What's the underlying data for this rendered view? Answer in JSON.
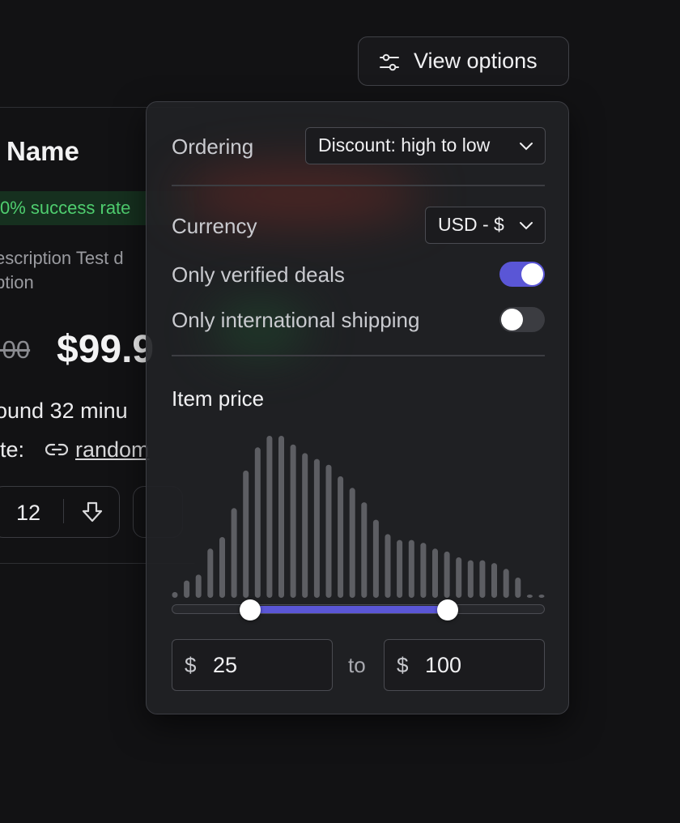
{
  "background_card": {
    "name": "Name",
    "success_rate": "0% success rate",
    "description_line1": "escription Test d",
    "description_line2": "ption",
    "old_price": ".00",
    "price": "$99.9",
    "found": "ound 32 minu",
    "site_label": "ite:",
    "site_link": "random",
    "vote_count": "12"
  },
  "view_options_button": {
    "label": "View options",
    "icon": "sliders-icon"
  },
  "panel": {
    "ordering": {
      "label": "Ordering",
      "selected": "Discount: high to low"
    },
    "currency": {
      "label": "Currency",
      "selected": "USD - $"
    },
    "only_verified_deals": {
      "label": "Only verified deals",
      "enabled": true
    },
    "only_international_shipping": {
      "label": "Only international shipping",
      "enabled": false
    },
    "item_price": {
      "title": "Item price",
      "histogram_counts": [
        2,
        6,
        8,
        17,
        21,
        31,
        44,
        52,
        56,
        56,
        53,
        50,
        48,
        46,
        42,
        38,
        33,
        27,
        22,
        20,
        20,
        19,
        17,
        16,
        14,
        13,
        13,
        12,
        10,
        7,
        1,
        1
      ],
      "range_fraction": [
        0.21,
        0.74
      ],
      "min": {
        "currency": "$",
        "value": "25"
      },
      "to_label": "to",
      "max": {
        "currency": "$",
        "value": "100"
      }
    }
  },
  "colors": {
    "accent": "#5a56d6",
    "histogram_bar": "#5d5e63",
    "success_text": "#4fce6f"
  }
}
